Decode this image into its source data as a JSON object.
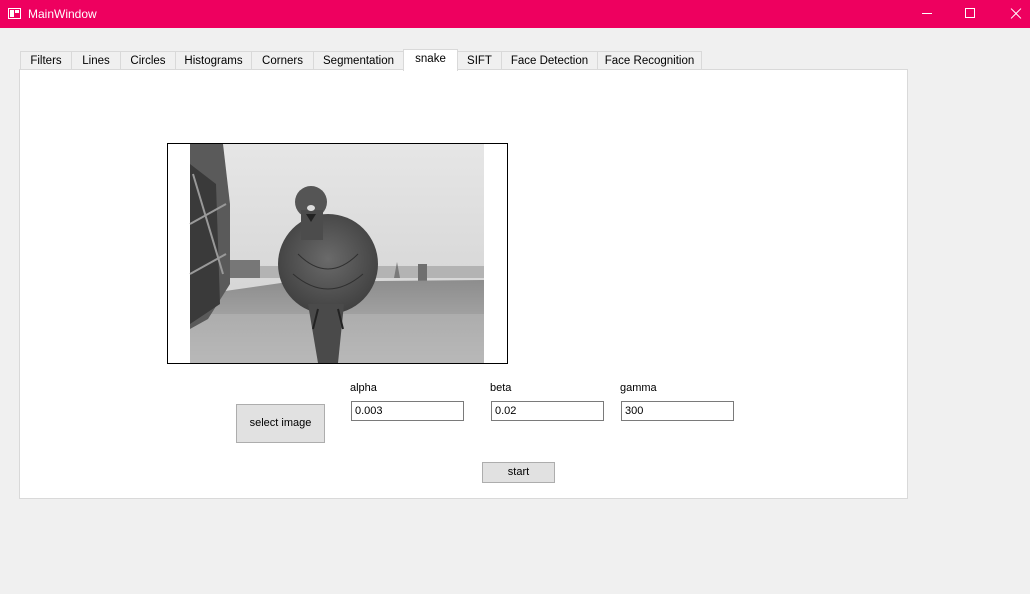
{
  "window": {
    "title": "MainWindow",
    "accent_color": "#ee005f",
    "controls": [
      "minimize-icon",
      "maximize-icon",
      "close-icon"
    ]
  },
  "tabs": [
    {
      "label": "Filters",
      "active": false
    },
    {
      "label": "Lines",
      "active": false
    },
    {
      "label": "Circles",
      "active": false
    },
    {
      "label": "Histograms",
      "active": false
    },
    {
      "label": "Corners",
      "active": false
    },
    {
      "label": "Segmentation",
      "active": false
    },
    {
      "label": "snake",
      "active": true
    },
    {
      "label": "SIFT",
      "active": false
    },
    {
      "label": "Face Detection",
      "active": false
    },
    {
      "label": "Face Recognition",
      "active": false
    }
  ],
  "snake": {
    "image_description": "grayscale photo of a pigeon on a rooftop ledge",
    "select_button": "select image",
    "alpha": {
      "label": "alpha",
      "value": "0.003"
    },
    "beta": {
      "label": "beta",
      "value": "0.02"
    },
    "gamma": {
      "label": "gamma",
      "value": "300"
    },
    "start_button": "start"
  }
}
